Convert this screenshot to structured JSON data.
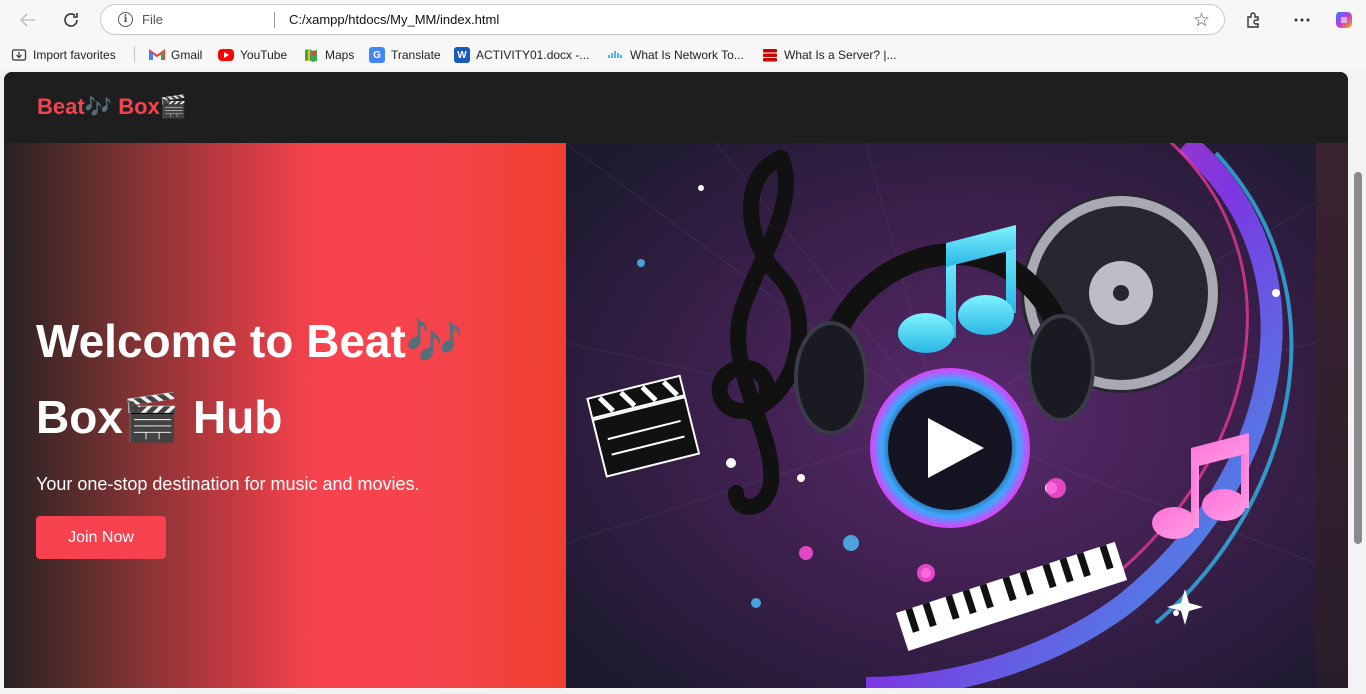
{
  "browser": {
    "back_icon": "back-arrow-icon",
    "refresh_icon": "refresh-icon",
    "address": {
      "scheme": "File",
      "url": "C:/xampp/htdocs/My_MM/index.html"
    },
    "bookmarks": [
      {
        "label": "Import favorites",
        "icon": "import-icon"
      },
      {
        "label": "Gmail",
        "icon": "gmail-icon",
        "color": "#ea4335"
      },
      {
        "label": "YouTube",
        "icon": "youtube-icon",
        "color": "#ff0000"
      },
      {
        "label": "Maps",
        "icon": "maps-icon",
        "color": "#34a853"
      },
      {
        "label": "Translate",
        "icon": "translate-icon",
        "color": "#4285f4"
      },
      {
        "label": "ACTIVITY01.docx -...",
        "icon": "word-icon",
        "color": "#185abd"
      },
      {
        "label": "What Is Network To...",
        "icon": "cisco-icon",
        "color": "#049fd9"
      },
      {
        "label": "What Is a Server? |...",
        "icon": "server-icon",
        "color": "#cc0000"
      }
    ]
  },
  "page": {
    "logo": "Beat🎶 Box🎬",
    "hero": {
      "title": "Welcome to Beat🎶 Box🎬 Hub",
      "subtitle": "Your one-stop destination for music and movies.",
      "cta_label": "Join Now"
    },
    "colors": {
      "accent": "#f5424e",
      "navbar_bg": "#1e1e1e"
    }
  }
}
